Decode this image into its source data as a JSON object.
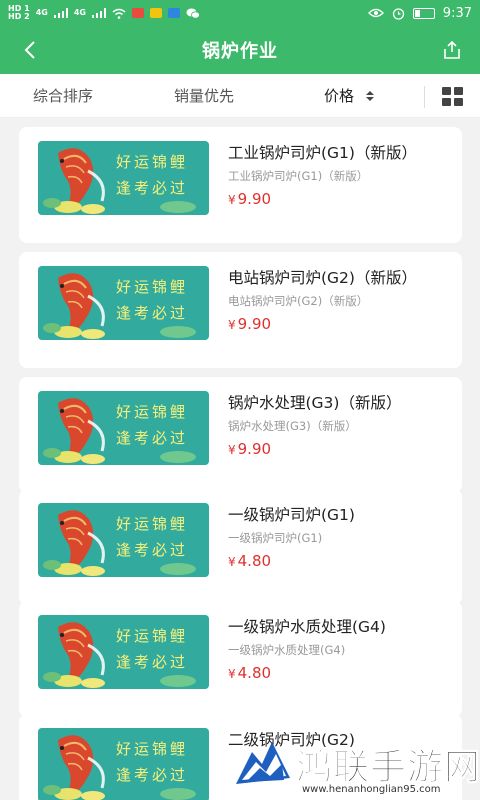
{
  "status_bar": {
    "left_labels": [
      "HD 1",
      "HD 2",
      "4G",
      "4G"
    ],
    "time": "9:37"
  },
  "nav": {
    "title": "锅炉作业"
  },
  "sort_tabs": [
    {
      "label": "综合排序",
      "active": false
    },
    {
      "label": "销量优先",
      "active": false
    },
    {
      "label": "价格",
      "active": true
    }
  ],
  "thumbnail": {
    "line1": "好运锦鲤",
    "line2": "逢考必过"
  },
  "products": [
    {
      "title": "工业锅炉司炉(G1)（新版）",
      "subtitle": "工业锅炉司炉(G1)（新版）",
      "currency": "¥",
      "price": "9.90"
    },
    {
      "title": "电站锅炉司炉(G2)（新版）",
      "subtitle": "电站锅炉司炉(G2)（新版）",
      "currency": "¥",
      "price": "9.90"
    },
    {
      "title": "锅炉水处理(G3)（新版）",
      "subtitle": "锅炉水处理(G3)（新版）",
      "currency": "¥",
      "price": "9.90"
    },
    {
      "title": "一级锅炉司炉(G1)",
      "subtitle": "一级锅炉司炉(G1)",
      "currency": "¥",
      "price": "4.80"
    },
    {
      "title": "一级锅炉水质处理(G4)",
      "subtitle": "一级锅炉水质处理(G4)",
      "currency": "¥",
      "price": "4.80"
    },
    {
      "title": "二级锅炉司炉(G2)",
      "subtitle": "",
      "currency": "",
      "price": ""
    }
  ],
  "watermark": {
    "name": "鸿联手游网",
    "url": "www.henanhonglian95.com"
  },
  "colors": {
    "header": "#3cb96a",
    "price": "#e0302e",
    "thumb_bg": "#2fa39a"
  }
}
